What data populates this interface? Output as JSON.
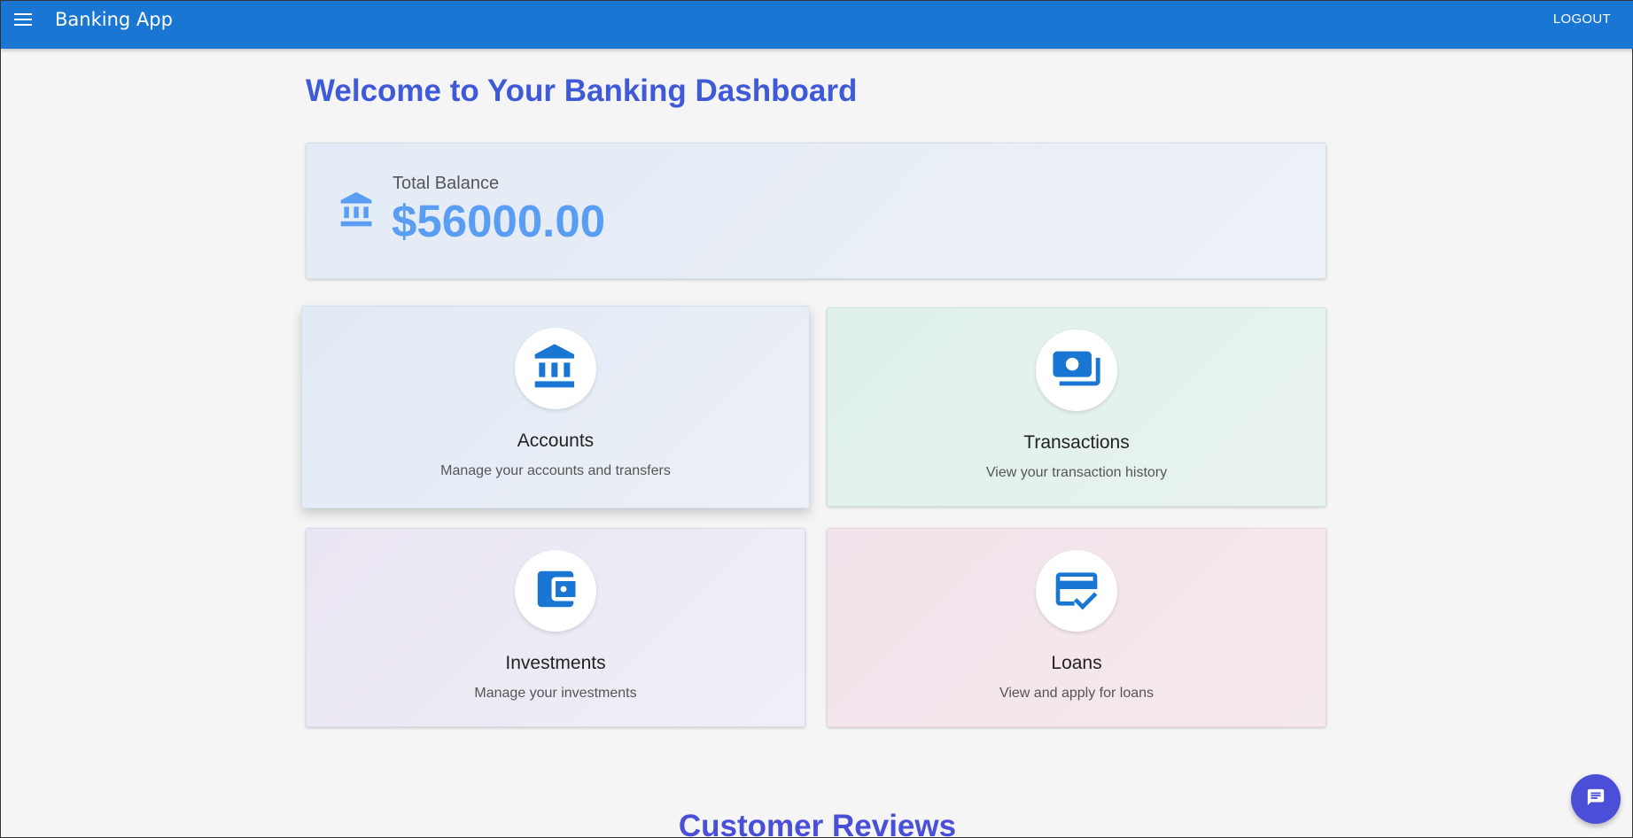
{
  "header": {
    "menu_icon": "hamburger-menu-icon",
    "title": "Banking App",
    "logout_label": "LOGOUT"
  },
  "main": {
    "welcome": "Welcome to Your Banking Dashboard",
    "balance": {
      "icon": "bank-icon",
      "label": "Total Balance",
      "amount": "$56000.00"
    },
    "tiles": [
      {
        "icon": "bank-icon",
        "title": "Accounts",
        "description": "Manage your accounts and transfers"
      },
      {
        "icon": "payments-icon",
        "title": "Transactions",
        "description": "View your transaction history"
      },
      {
        "icon": "wallet-icon",
        "title": "Investments",
        "description": "Manage your investments"
      },
      {
        "icon": "credit-score-icon",
        "title": "Loans",
        "description": "View and apply for loans"
      }
    ],
    "reviews_heading": "Customer Reviews"
  },
  "chat": {
    "icon": "chat-icon"
  },
  "colors": {
    "appbar": "#1976d2",
    "accent": "#3f5ad8",
    "balance_amount": "#5a9ef4",
    "icon_blue": "#1976d2",
    "fab": "#4b4fd8"
  }
}
